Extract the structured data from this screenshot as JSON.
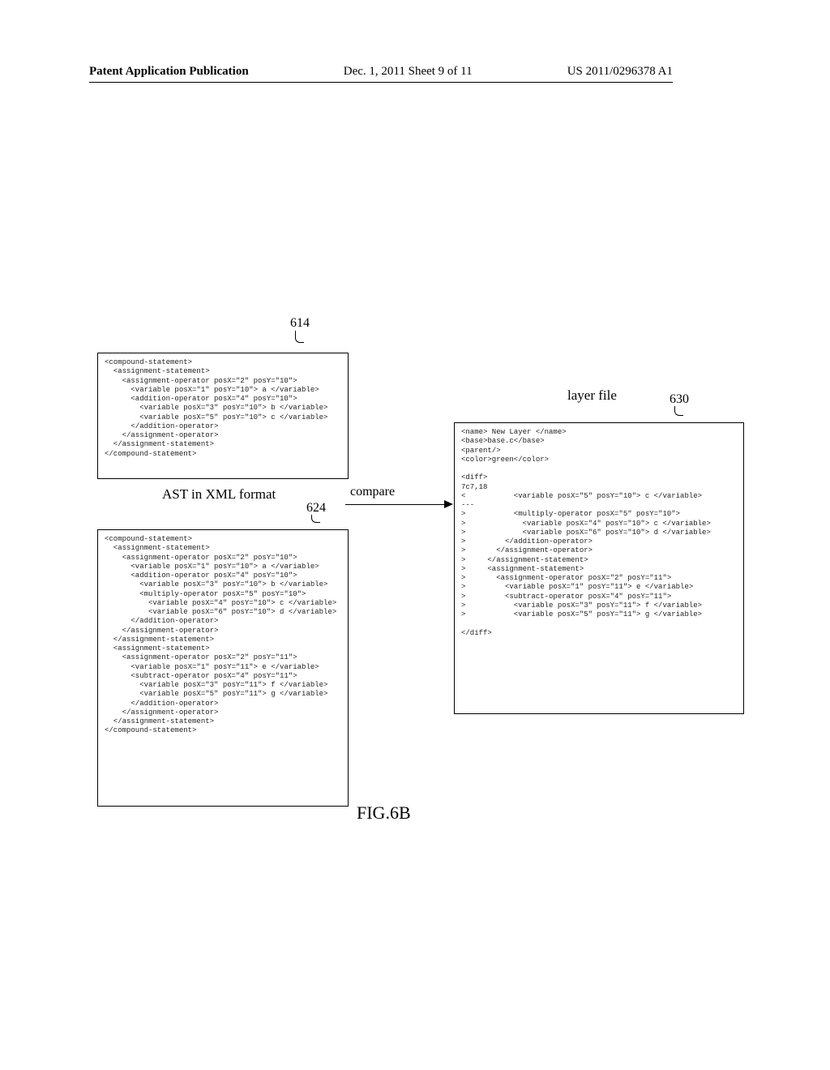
{
  "header": {
    "left": "Patent Application Publication",
    "center": "Dec. 1, 2011  Sheet 9 of 11",
    "right": "US 2011/0296378 A1"
  },
  "refs": {
    "r614": "614",
    "r624": "624",
    "r630": "630"
  },
  "labels": {
    "ast_xml": "AST in XML format",
    "compare": "compare",
    "layer_file": "layer file"
  },
  "figure_caption": "FIG.6B",
  "box614_text": "<compound-statement>\n  <assignment-statement>\n    <assignment-operator posX=\"2\" posY=\"10\">\n      <variable posX=\"1\" posY=\"10\"> a </variable>\n      <addition-operator posX=\"4\" posY=\"10\">\n        <variable posX=\"3\" posY=\"10\"> b </variable>\n        <variable posX=\"5\" posY=\"10\"> c </variable>\n      </addition-operator>\n    </assignment-operator>\n  </assignment-statement>\n</compound-statement>",
  "box624_text": "<compound-statement>\n  <assignment-statement>\n    <assignment-operator posX=\"2\" posY=\"10\">\n      <variable posX=\"1\" posY=\"10\"> a </variable>\n      <addition-operator posX=\"4\" posY=\"10\">\n        <variable posX=\"3\" posY=\"10\"> b </variable>\n        <multiply-operator posX=\"5\" posY=\"10\">\n          <variable posX=\"4\" posY=\"10\"> c </variable>\n          <variable posX=\"6\" posY=\"10\"> d </variable>\n      </addition-operator>\n    </assignment-operator>\n  </assignment-statement>\n  <assignment-statement>\n    <assignment-operator posX=\"2\" posY=\"11\">\n      <variable posX=\"1\" posY=\"11\"> e </variable>\n      <subtract-operator posX=\"4\" posY=\"11\">\n        <variable posX=\"3\" posY=\"11\"> f </variable>\n        <variable posX=\"5\" posY=\"11\"> g </variable>\n      </addition-operator>\n    </assignment-operator>\n  </assignment-statement>\n</compound-statement>",
  "box630_text": "<name> New Layer </name>\n<base>base.c</base>\n<parent/>\n<color>green</color>\n\n<diff>\n7c7,18\n<           <variable posX=\"5\" posY=\"10\"> c </variable>\n---\n>           <multiply-operator posX=\"5\" posY=\"10\">\n>             <variable posX=\"4\" posY=\"10\"> c </variable>\n>             <variable posX=\"6\" posY=\"10\"> d </variable>\n>         </addition-operator>\n>       </assignment-operator>\n>     </assignment-statement>\n>     <assignment-statement>\n>       <assignment-operator posX=\"2\" posY=\"11\">\n>         <variable posX=\"1\" posY=\"11\"> e </variable>\n>         <subtract-operator posX=\"4\" posY=\"11\">\n>           <variable posX=\"3\" posY=\"11\"> f </variable>\n>           <variable posX=\"5\" posY=\"11\"> g </variable>\n\n</diff>"
}
